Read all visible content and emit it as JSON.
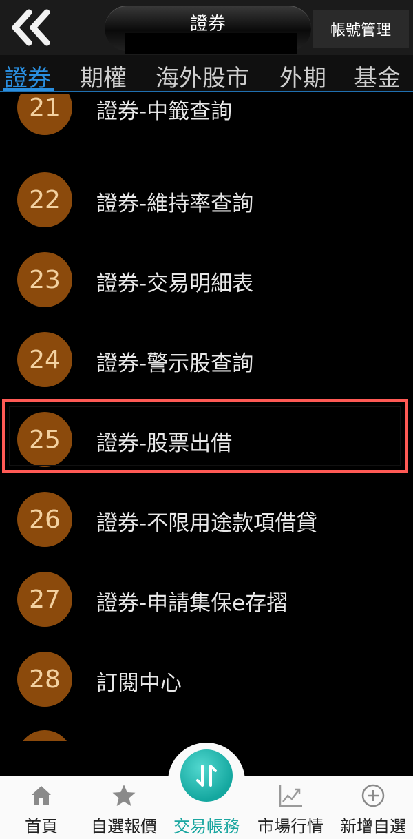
{
  "header": {
    "title": "證券",
    "account_button": "帳號管理"
  },
  "tabs": [
    {
      "label": "證券",
      "active": true
    },
    {
      "label": "期權",
      "active": false
    },
    {
      "label": "海外股市",
      "active": false
    },
    {
      "label": "外期",
      "active": false
    },
    {
      "label": "基金",
      "active": false
    }
  ],
  "items": [
    {
      "number": "21",
      "label": "證券-中籤查詢"
    },
    {
      "number": "22",
      "label": "證券-維持率查詢"
    },
    {
      "number": "23",
      "label": "證券-交易明細表"
    },
    {
      "number": "24",
      "label": "證券-警示股查詢"
    },
    {
      "number": "25",
      "label": "證券-股票出借"
    },
    {
      "number": "26",
      "label": "證券-不限用途款項借貸"
    },
    {
      "number": "27",
      "label": "證券-申請集保e存摺"
    },
    {
      "number": "28",
      "label": "訂閱中心"
    }
  ],
  "bottom_nav": [
    {
      "label": "首頁",
      "icon": "home-icon"
    },
    {
      "label": "自選報價",
      "icon": "star-icon"
    },
    {
      "label": "交易帳務",
      "icon": "trade-transfer-icon",
      "active": true
    },
    {
      "label": "市場行情",
      "icon": "chart-icon"
    },
    {
      "label": "新增自選",
      "icon": "plus-circle-icon"
    }
  ],
  "colors": {
    "badge": "#8b4a0c",
    "badge_text": "#f3d1a0",
    "tab_active": "#2a8fe0",
    "highlight": "#ff5a55",
    "nav_active": "#1aa6a0"
  }
}
